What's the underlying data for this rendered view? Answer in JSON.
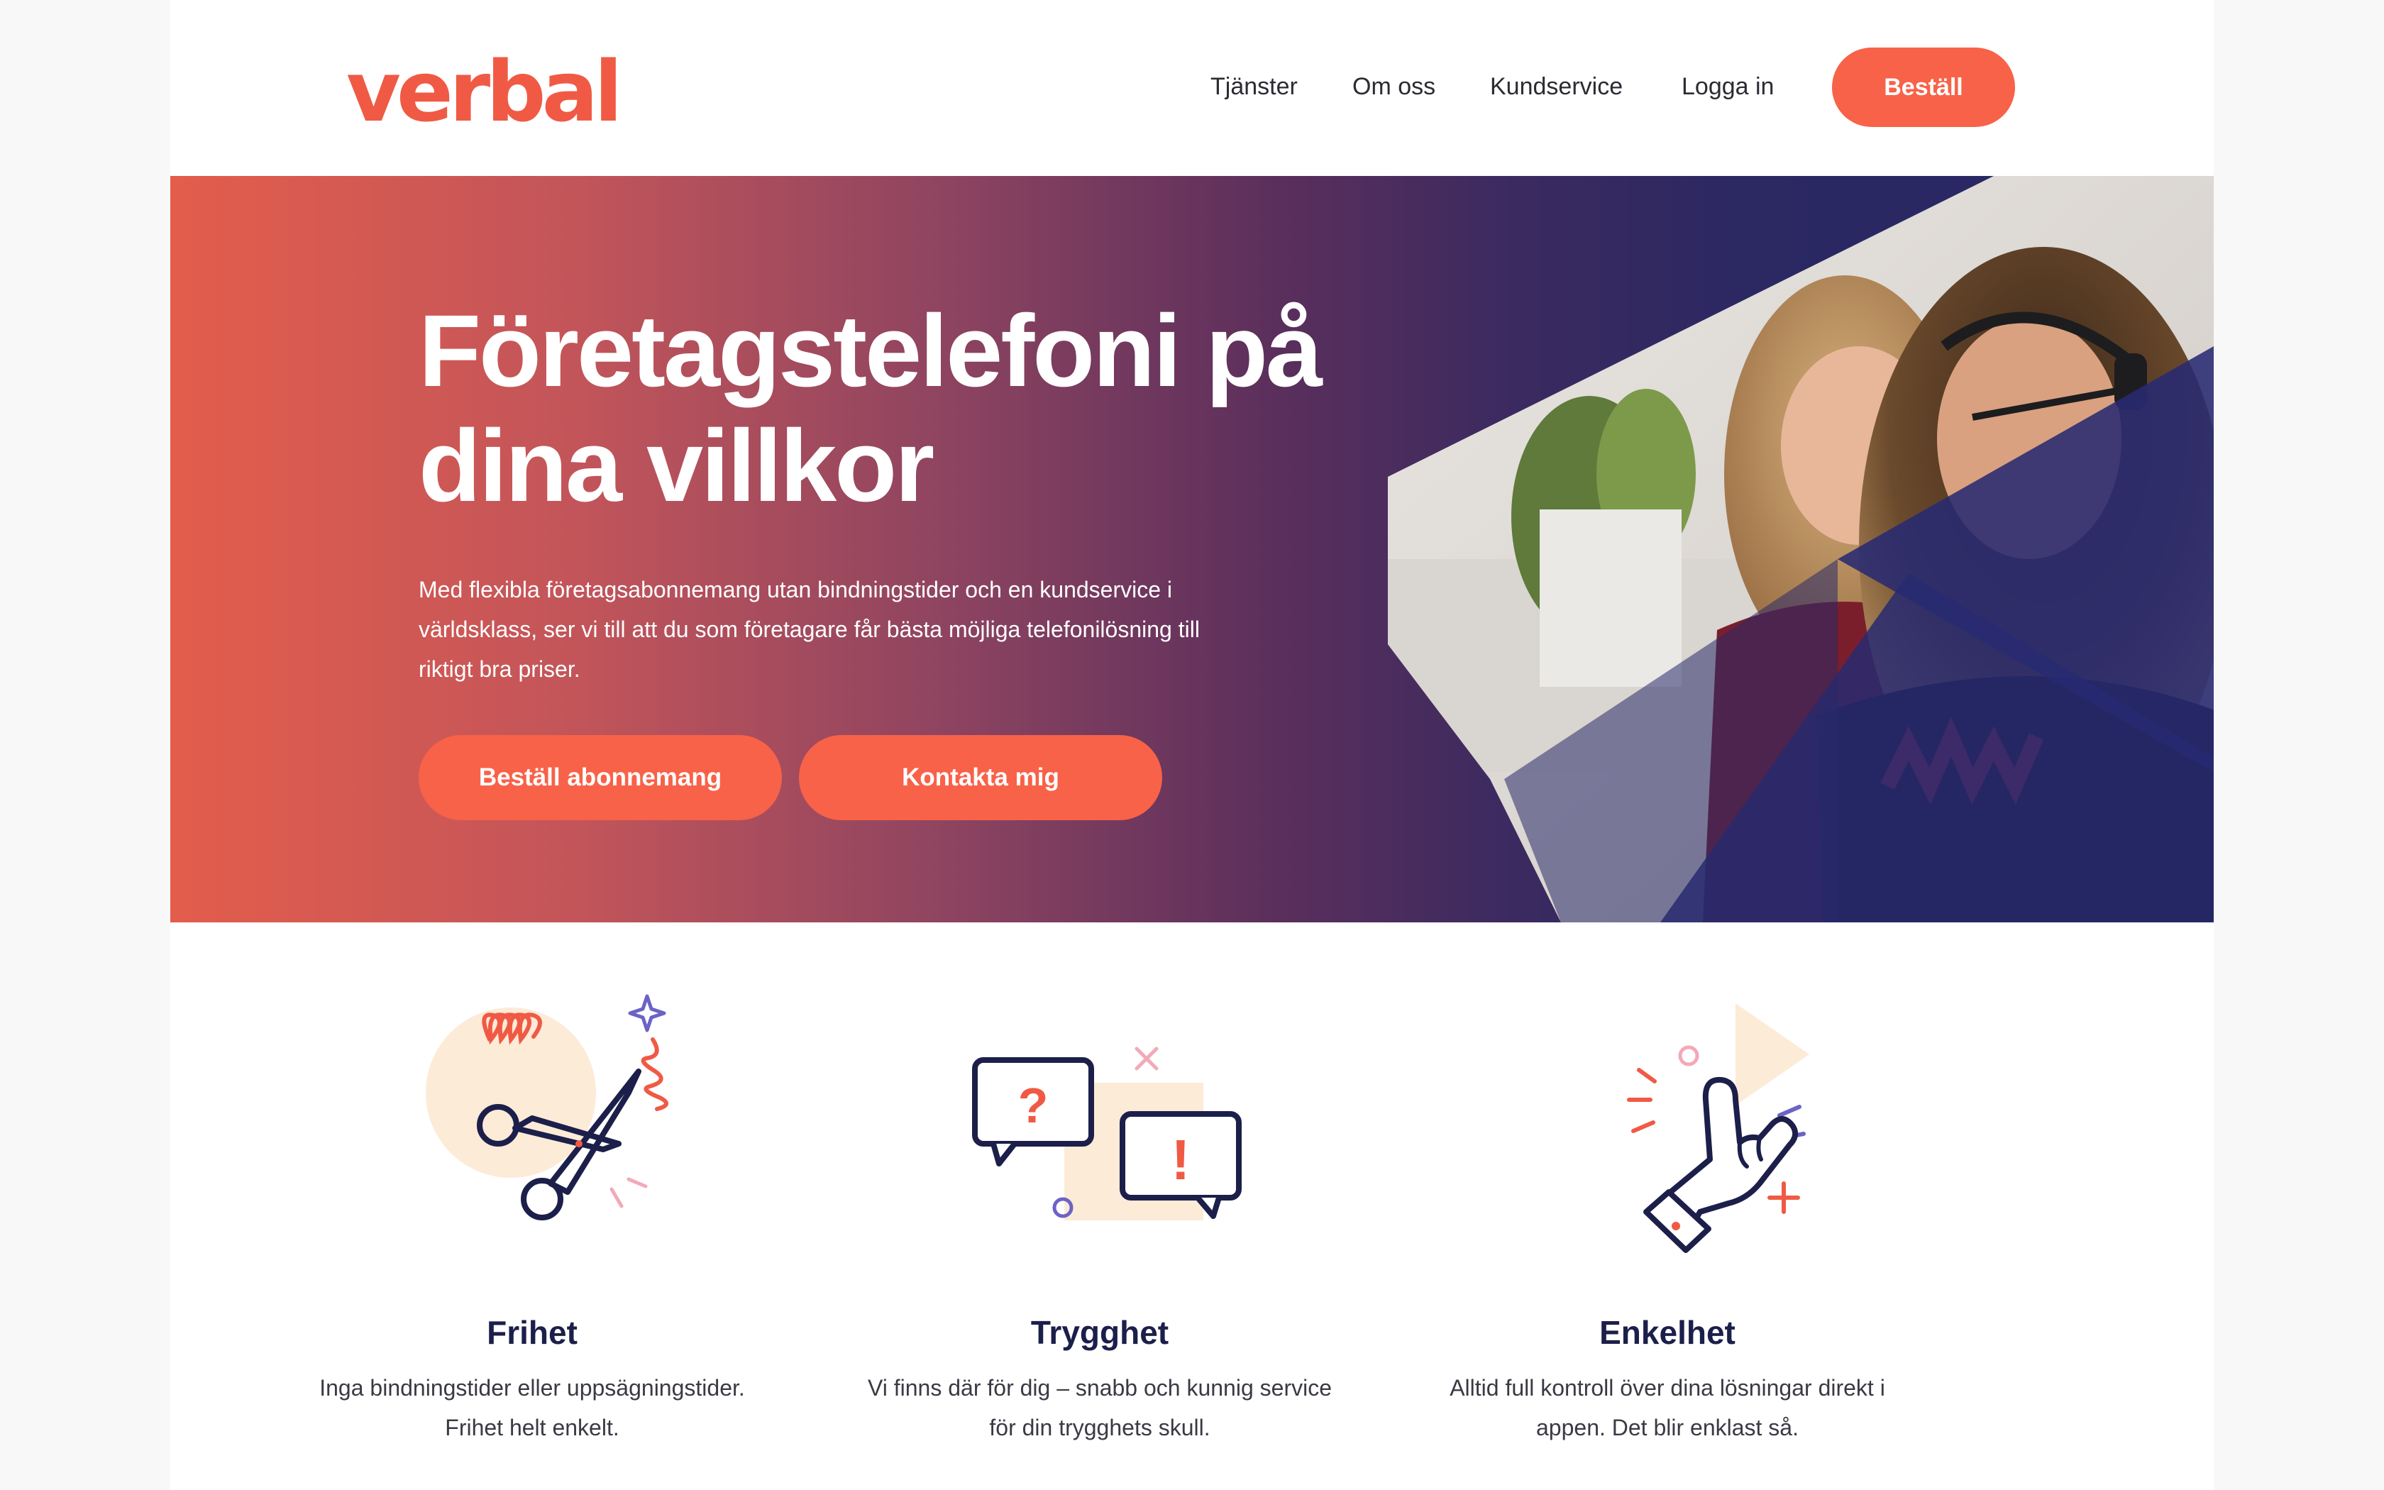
{
  "brand": {
    "logo": "verbal",
    "accent": "#f86248",
    "navy": "#1c1f4a"
  },
  "nav": {
    "items": [
      "Tjänster",
      "Om oss",
      "Kundservice",
      "Logga in"
    ],
    "cta": "Beställ"
  },
  "hero": {
    "title_line1": "Företagstelefoni på",
    "title_line2": "dina villkor",
    "text_line1": "Med flexibla företagsabonnemang utan bindningstider och en kundservice i",
    "text_line2": "världsklass, ser vi till att du som företagare får bästa möjliga telefonilösning till",
    "text_line3": "riktigt bra priser.",
    "primary_button": "Beställ abonnemang",
    "secondary_button": "Kontakta mig"
  },
  "features": [
    {
      "icon": "scissors-icon",
      "title": "Frihet",
      "line1": "Inga bindningstider eller uppsägningstider.",
      "line2": "Frihet helt enkelt."
    },
    {
      "icon": "chat-bubbles-icon",
      "title": "Trygghet",
      "line1": "Vi finns där för dig – snabb och kunnig service",
      "line2": "för din trygghets skull."
    },
    {
      "icon": "hand-gesture-icon",
      "title": "Enkelhet",
      "line1": "Alltid full kontroll över dina lösningar direkt i",
      "line2": "appen. Det blir enklast så."
    }
  ]
}
